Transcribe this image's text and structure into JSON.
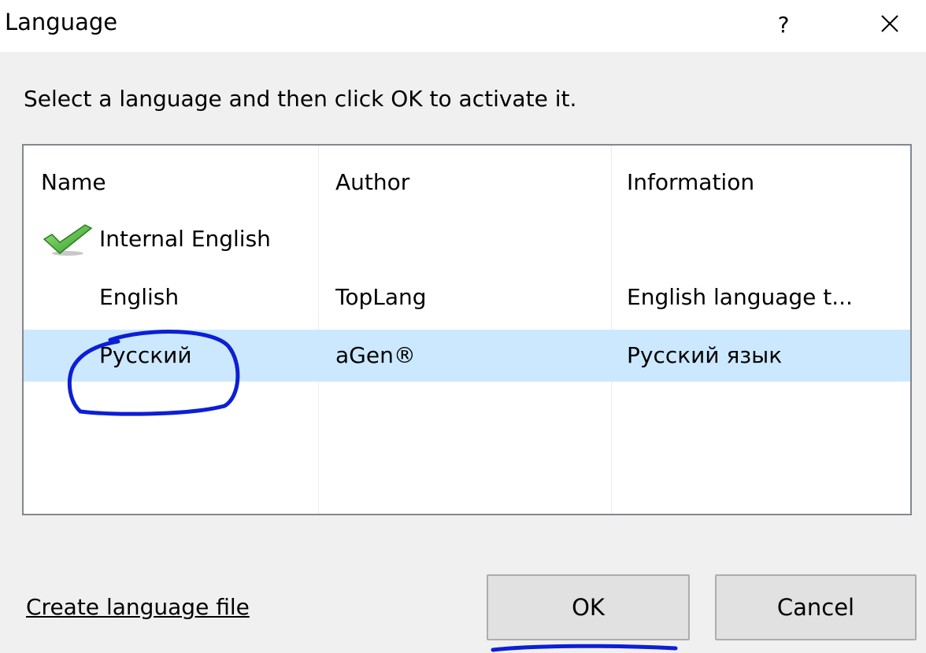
{
  "window": {
    "title": "Language",
    "help_glyph": "?",
    "close_icon": "close-icon"
  },
  "instruction": "Select a language and then click OK to activate it.",
  "list": {
    "columns": [
      "Name",
      "Author",
      "Information"
    ],
    "rows": [
      {
        "name": "Internal English",
        "author": "",
        "information": "",
        "active": true,
        "icon": "checkmark-icon"
      },
      {
        "name": "English",
        "author": "TopLang",
        "information": "English language t...",
        "active": false
      },
      {
        "name": "Русский",
        "author": "aGen®",
        "information": "Русский язык",
        "active": false,
        "selected": true
      }
    ]
  },
  "footer": {
    "create_link": "Create language file",
    "ok_label": "OK",
    "cancel_label": "Cancel"
  },
  "colors": {
    "selection": "#cce8ff",
    "annotation": "#0b1fd6",
    "dialog_bg": "#f0f0f0"
  }
}
